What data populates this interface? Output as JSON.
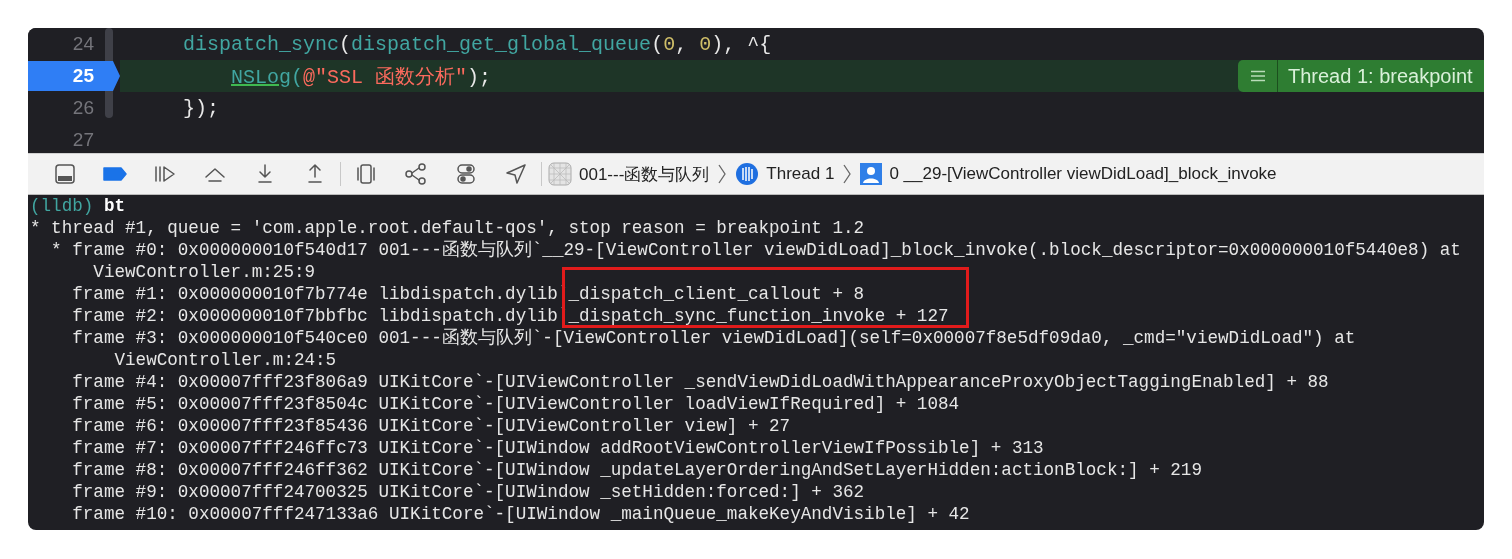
{
  "editor": {
    "lines": [
      {
        "number": "24",
        "current": false,
        "tokens": [
          {
            "text": "    dispatch_sync",
            "kind": "func"
          },
          {
            "text": "(",
            "kind": "plain"
          },
          {
            "text": "dispatch_get_global_queue",
            "kind": "func"
          },
          {
            "text": "(",
            "kind": "plain"
          },
          {
            "text": "0",
            "kind": "num"
          },
          {
            "text": ", ",
            "kind": "plain"
          },
          {
            "text": "0",
            "kind": "num"
          },
          {
            "text": "), ^{",
            "kind": "plain"
          }
        ]
      },
      {
        "number": "25",
        "current": true,
        "tokens": [
          {
            "text": "        NSLog",
            "kind": "macro"
          },
          {
            "text": "(",
            "kind": "func"
          },
          {
            "text": "@\"SSL 函数分析\"",
            "kind": "string"
          },
          {
            "text": ");",
            "kind": "plain"
          }
        ]
      },
      {
        "number": "26",
        "current": false,
        "tokens": [
          {
            "text": "    });",
            "kind": "plain"
          }
        ]
      },
      {
        "number": "27",
        "current": false
      }
    ],
    "annotation": {
      "text": "Thread 1: breakpoint"
    }
  },
  "toolbar": {
    "buttons": [
      {
        "kind": "debug-area",
        "active": false
      },
      {
        "kind": "breakpoints",
        "active": true
      },
      {
        "kind": "continue",
        "active": false
      },
      {
        "kind": "step-over",
        "active": false
      },
      {
        "kind": "step-into",
        "active": false
      },
      {
        "kind": "step-out",
        "active": false
      },
      {
        "kind": "divider"
      },
      {
        "kind": "view-debugger",
        "active": false
      },
      {
        "kind": "memory-graph",
        "active": false
      },
      {
        "kind": "environment",
        "active": false
      },
      {
        "kind": "location",
        "active": false
      },
      {
        "kind": "divider"
      }
    ],
    "breadcrumb": [
      {
        "kind": "app",
        "text": "001---函数与队列"
      },
      {
        "kind": "thread",
        "text": "Thread 1"
      },
      {
        "kind": "frame",
        "text": "0 __29-[ViewController viewDidLoad]_block_invoke"
      }
    ]
  },
  "console": {
    "prompt": "(lldb)",
    "command": "bt",
    "lines": [
      "* thread #1, queue = 'com.apple.root.default-qos', stop reason = breakpoint 1.2",
      "  * frame #0: 0x000000010f540d17 001---函数与队列`__29-[ViewController viewDidLoad]_block_invoke(.block_descriptor=0x000000010f5440e8) at",
      "      ViewController.m:25:9",
      "    frame #1: 0x000000010f7b774e libdispatch.dylib`_dispatch_client_callout + 8",
      "    frame #2: 0x000000010f7bbfbc libdispatch.dylib`_dispatch_sync_function_invoke + 127",
      "    frame #3: 0x000000010f540ce0 001---函数与队列`-[ViewController viewDidLoad](self=0x00007f8e5df09da0, _cmd=\"viewDidLoad\") at",
      "        ViewController.m:24:5",
      "    frame #4: 0x00007fff23f806a9 UIKitCore`-[UIViewController _sendViewDidLoadWithAppearanceProxyObjectTaggingEnabled] + 88",
      "    frame #5: 0x00007fff23f8504c UIKitCore`-[UIViewController loadViewIfRequired] + 1084",
      "    frame #6: 0x00007fff23f85436 UIKitCore`-[UIViewController view] + 27",
      "    frame #7: 0x00007fff246ffc73 UIKitCore`-[UIWindow addRootViewControllerViewIfPossible] + 313",
      "    frame #8: 0x00007fff246ff362 UIKitCore`-[UIWindow _updateLayerOrderingAndSetLayerHidden:actionBlock:] + 219",
      "    frame #9: 0x00007fff24700325 UIKitCore`-[UIWindow _setHidden:forced:] + 362",
      "    frame #10: 0x00007fff247133a6 UIKitCore`-[UIWindow _mainQueue_makeKeyAndVisible] + 42"
    ]
  }
}
